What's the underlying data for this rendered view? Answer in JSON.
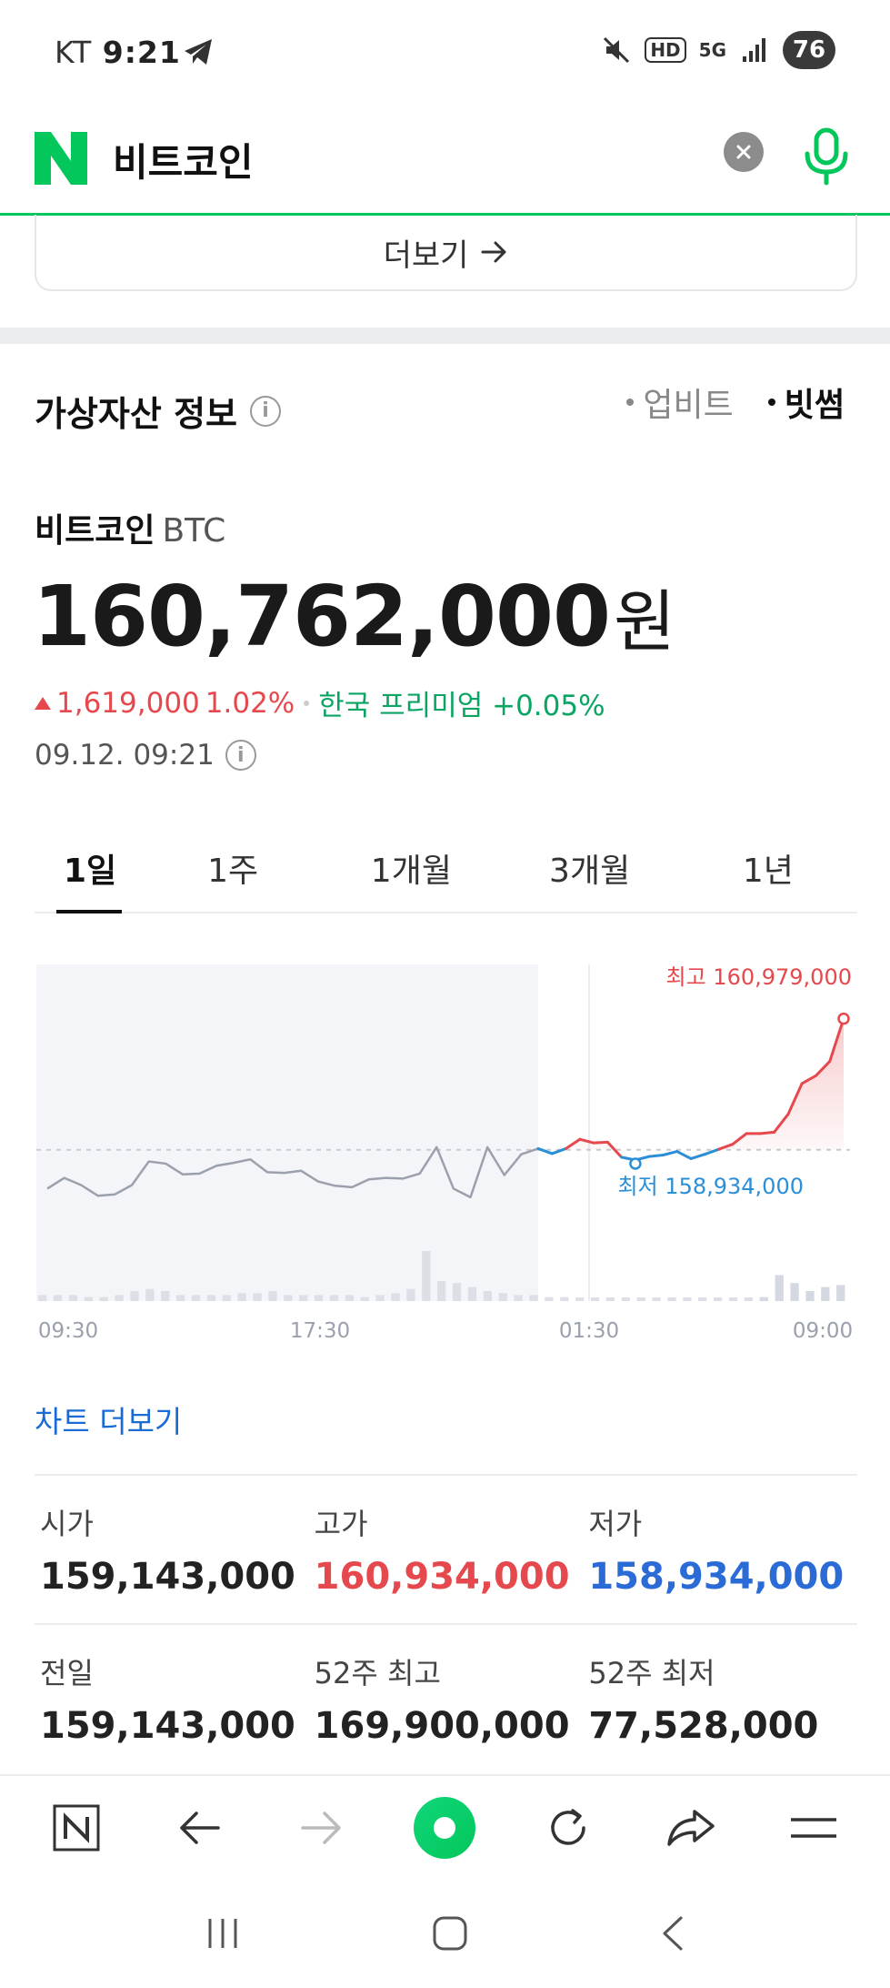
{
  "status": {
    "carrier": "KT",
    "time": "9:21",
    "battery": "76",
    "hd_label": "HD",
    "network": "5G"
  },
  "search": {
    "query": "비트코인"
  },
  "more_button": "더보기",
  "section": {
    "title": "가상자산 정보",
    "exchanges": [
      "업비트",
      "빗썸"
    ],
    "active_exchange": "빗썸"
  },
  "coin": {
    "name": "비트코인",
    "ticker": "BTC",
    "price": "160,762,000",
    "unit": "원",
    "change_amount": "1,619,000",
    "change_pct": "1.02%",
    "premium": "한국 프리미엄 +0.05%",
    "timestamp": "09.12. 09:21"
  },
  "tabs": [
    "1일",
    "1주",
    "1개월",
    "3개월",
    "1년"
  ],
  "active_tab": "1일",
  "chart_data": {
    "type": "line",
    "x_ticks": [
      "09:30",
      "17:30",
      "01:30",
      "09:00"
    ],
    "high_label": "최고 160,979,000",
    "low_label": "최저 158,934,000",
    "reference_value": 159143000,
    "ylim": [
      158300000,
      161100000
    ],
    "series_past": [
      158600000,
      158750000,
      158650000,
      158500000,
      158520000,
      158650000,
      158980000,
      158950000,
      158800000,
      158810000,
      158920000,
      158960000,
      159010000,
      158830000,
      158820000,
      158850000,
      158700000,
      158640000,
      158620000,
      158730000,
      158750000,
      158740000,
      158810000,
      159180000,
      158600000,
      158480000,
      159180000,
      158790000,
      159080000,
      159160000
    ],
    "series_recent": [
      159160000,
      159090000,
      159160000,
      159290000,
      159240000,
      159250000,
      159040000,
      159000000,
      159050000,
      159070000,
      159120000,
      159020000,
      159080000,
      159150000,
      159220000,
      159370000,
      159370000,
      159390000,
      159640000,
      160070000,
      160180000,
      160380000,
      160978000
    ],
    "colors": {
      "up": "#e5484d",
      "down": "#2b8fd8",
      "past": "#9aa1ad"
    },
    "volume": [
      3,
      3,
      3,
      2,
      2,
      3,
      5,
      6,
      5,
      3,
      3,
      3,
      3,
      4,
      4,
      5,
      3,
      3,
      3,
      3,
      3,
      2,
      3,
      4,
      6,
      25,
      10,
      9,
      7,
      5,
      4,
      3,
      3,
      2,
      2,
      1,
      1,
      1,
      1,
      1,
      1,
      1,
      1,
      1,
      1,
      1,
      1,
      2,
      13,
      9,
      5,
      7,
      8
    ]
  },
  "chart_more": "차트 더보기",
  "stats_row1": [
    {
      "label": "시가",
      "value": "159,143,000",
      "tone": "normal"
    },
    {
      "label": "고가",
      "value": "160,934,000",
      "tone": "red"
    },
    {
      "label": "저가",
      "value": "158,934,000",
      "tone": "blue"
    }
  ],
  "stats_row2": [
    {
      "label": "전일",
      "value": "159,143,000",
      "tone": "normal"
    },
    {
      "label": "52주 최고",
      "value": "169,900,000",
      "tone": "normal"
    },
    {
      "label": "52주 최저",
      "value": "77,528,000",
      "tone": "normal"
    }
  ]
}
